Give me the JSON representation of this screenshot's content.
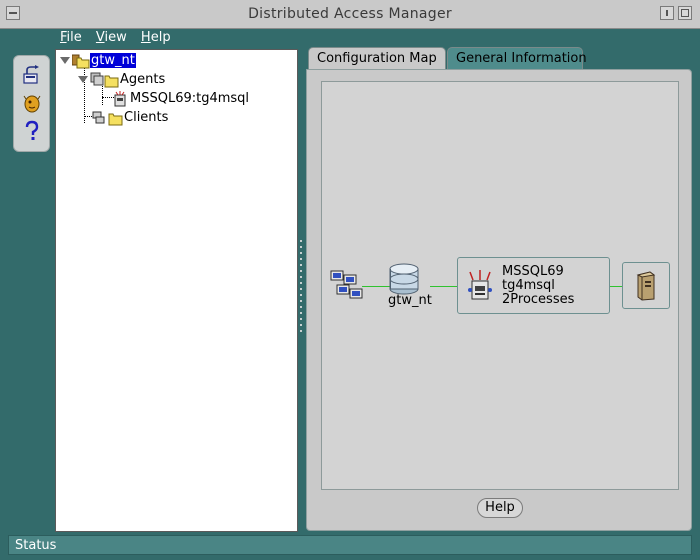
{
  "window": {
    "title": "Distributed Access Manager"
  },
  "menu": {
    "file": "File",
    "view": "View",
    "help": "Help"
  },
  "tree": {
    "root": "gtw_nt",
    "agents": "Agents",
    "agent_item": "MSSQL69:tg4msql",
    "clients": "Clients"
  },
  "tabs": {
    "config_map": "Configuration Map",
    "general_info": "General Information"
  },
  "map": {
    "gateway_label": "gtw_nt",
    "agent_name": "MSSQL69",
    "agent_sid": "tg4msql",
    "agent_processes": "2Processes"
  },
  "buttons": {
    "help": "Help"
  },
  "status": {
    "text": "Status"
  },
  "colors": {
    "background": "#336b6b",
    "selection": "#0000d8",
    "connector": "#2fc22f"
  }
}
